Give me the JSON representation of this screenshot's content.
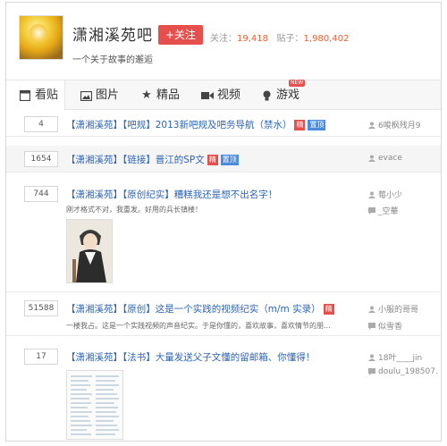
{
  "header": {
    "forum_name": "潇湘溪苑吧",
    "follow_label": "+关注",
    "follow_count_label": "关注：",
    "follow_count": "19,418",
    "post_count_label": "贴子：",
    "post_count": "1,980,402",
    "slogan": "一个关于故事的邂逅"
  },
  "tabs": [
    {
      "label": "看贴",
      "icon": "posts-icon"
    },
    {
      "label": "图片",
      "icon": "image-icon"
    },
    {
      "label": "精品",
      "icon": "star-icon"
    },
    {
      "label": "视频",
      "icon": "video-icon"
    },
    {
      "label": "游戏",
      "icon": "game-icon",
      "badge": "NEW"
    }
  ],
  "threads": [
    {
      "replies": "4",
      "title": "【潇湘溪苑】【吧规】2013新吧规及吧务导航（禁水）",
      "tags": [
        "精",
        "置顶"
      ],
      "author": "6唆枫残月9"
    },
    {
      "replies": "1654",
      "title": "【潇湘溪苑】【链接】晋江的SP文",
      "tags": [
        "精",
        "置顶"
      ],
      "author": "evace"
    },
    {
      "replies": "744",
      "title": "【潇湘溪苑】【原创纪实】糟糕我还是想不出名字！",
      "abstract": "刚才格式不对，我重发。好用的兵长镇楼！",
      "author": "莓小少",
      "last_reply": "_空華"
    },
    {
      "replies": "51588",
      "title": "【潇湘溪苑】【原创】这是一个实践的视频纪实（m/m 实录）",
      "tags": [
        "精"
      ],
      "abstract": "一楼我占。这是一个实践视频的声音纪实。于是你懂的，喜欢故事，喜欢情节的朋...",
      "author": "小服的哥哥",
      "last_reply": "似雪香"
    },
    {
      "replies": "17",
      "title": "【潇湘溪苑】【法书】大量发送父子文懂的留邮箱、你懂得！",
      "author": "18叶____jin",
      "last_reply": "doulu_198507."
    }
  ],
  "colors": {
    "accent_red": "#e5504d",
    "link_blue": "#2d64b3",
    "stat_orange": "#f05d2b",
    "tag_blue": "#4b8ddc"
  }
}
